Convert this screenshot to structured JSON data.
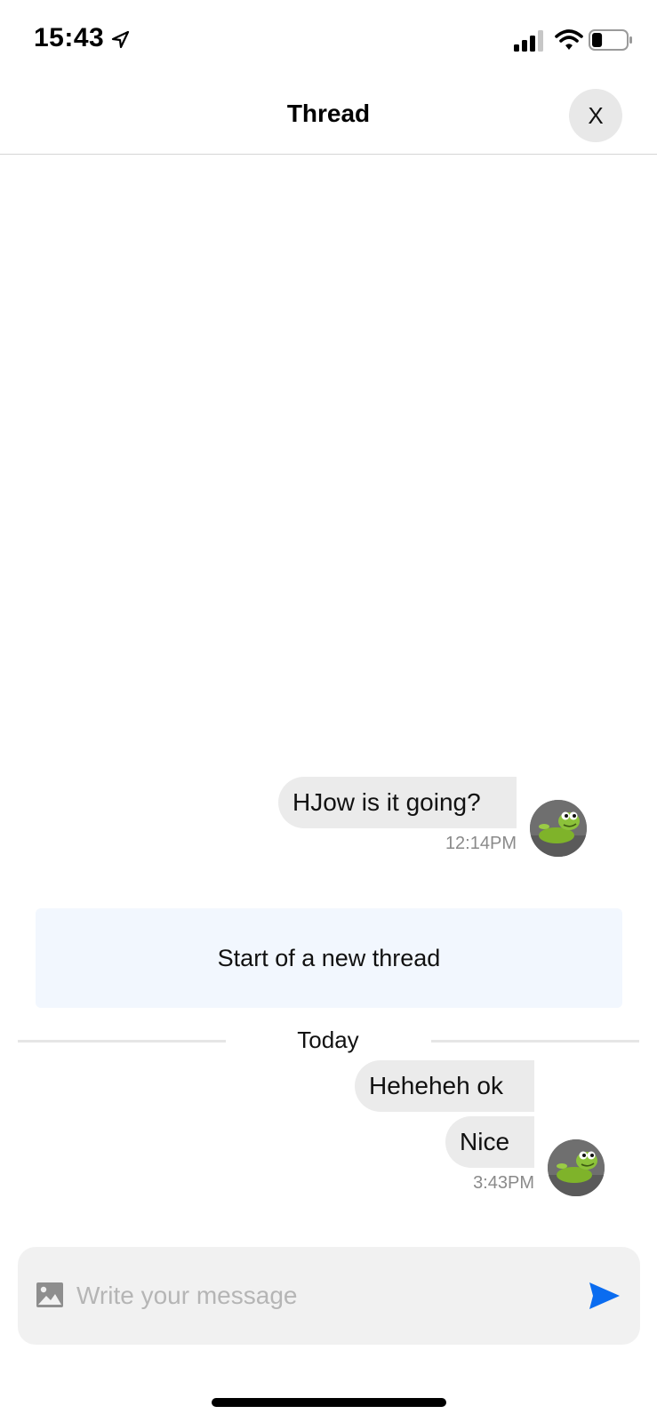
{
  "status_bar": {
    "time": "15:43",
    "location_icon": "location-arrow-icon",
    "signal_icon": "cellular-signal-icon",
    "wifi_icon": "wifi-icon",
    "battery_icon": "battery-icon",
    "battery_level": 0.3
  },
  "header": {
    "title": "Thread",
    "close_label": "X"
  },
  "messages": [
    {
      "text": "HJow is it going?",
      "time": "12:14PM",
      "avatar_icon": "frog-avatar"
    },
    {
      "text": "Heheheh ok"
    },
    {
      "text": "Nice",
      "time": "3:43PM",
      "avatar_icon": "frog-avatar"
    }
  ],
  "thread_marker": {
    "text": "Start of a new thread"
  },
  "date_divider": {
    "text": "Today"
  },
  "composer": {
    "placeholder": "Write your message",
    "value": "",
    "image_icon": "image-icon",
    "send_icon": "send-icon"
  },
  "colors": {
    "accent": "#0a6cf0",
    "bubble": "#ebebeb",
    "thread_marker_bg": "#f2f7fe",
    "timestamp": "#8a8a8a"
  }
}
